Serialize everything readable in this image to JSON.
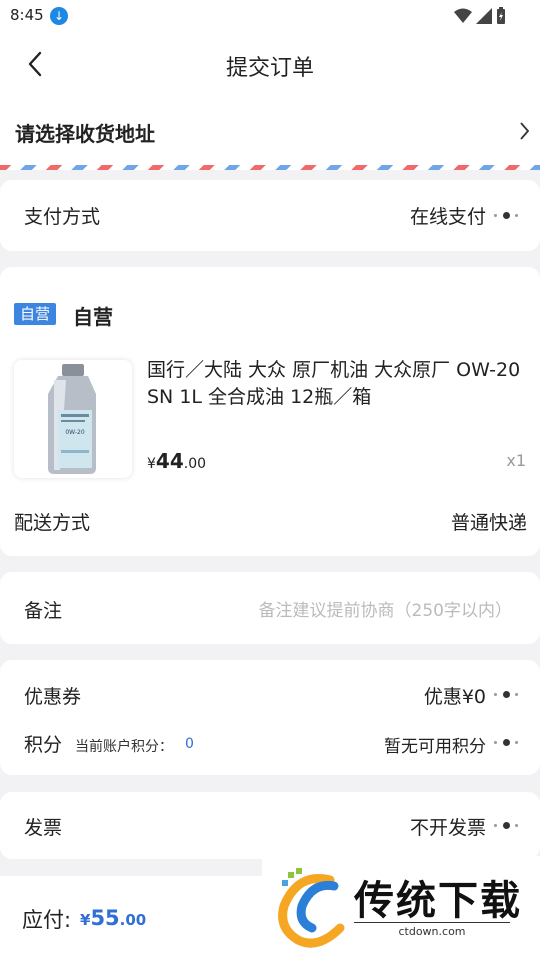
{
  "status_bar": {
    "time": "8:45"
  },
  "nav": {
    "title": "提交订单"
  },
  "address": {
    "label": "请选择收货地址"
  },
  "payment": {
    "label": "支付方式",
    "value": "在线支付"
  },
  "shop": {
    "badge": "自营",
    "name": "自营"
  },
  "product": {
    "name": "国行／大陆 大众 原厂机油 大众原厂 OW-20 SN 1L 全合成油 12瓶／箱",
    "price_symbol": "¥",
    "price_int": "44",
    "price_dec": ".00",
    "qty": "x1",
    "bottle_label": "0W-20"
  },
  "delivery": {
    "label": "配送方式",
    "value": "普通快递"
  },
  "remark": {
    "label": "备注",
    "placeholder": "备注建议提前协商（250字以内）"
  },
  "coupon": {
    "label": "优惠券",
    "value": "优惠¥0"
  },
  "points": {
    "label": "积分",
    "sub_label": "当前账户积分：",
    "sub_value": "0",
    "value": "暂无可用积分"
  },
  "invoice": {
    "label": "发票",
    "value": "不开发票"
  },
  "total": {
    "label": "应付:",
    "symbol": "¥",
    "int": "55",
    "dec": ".00"
  },
  "watermark": {
    "title": "传统下载",
    "url": "ctdown.com"
  },
  "colors": {
    "accent": "#2f6fd6",
    "badge": "#3d86e0",
    "stripe_red": "#f06a6a",
    "stripe_blue": "#6fa6e8"
  }
}
